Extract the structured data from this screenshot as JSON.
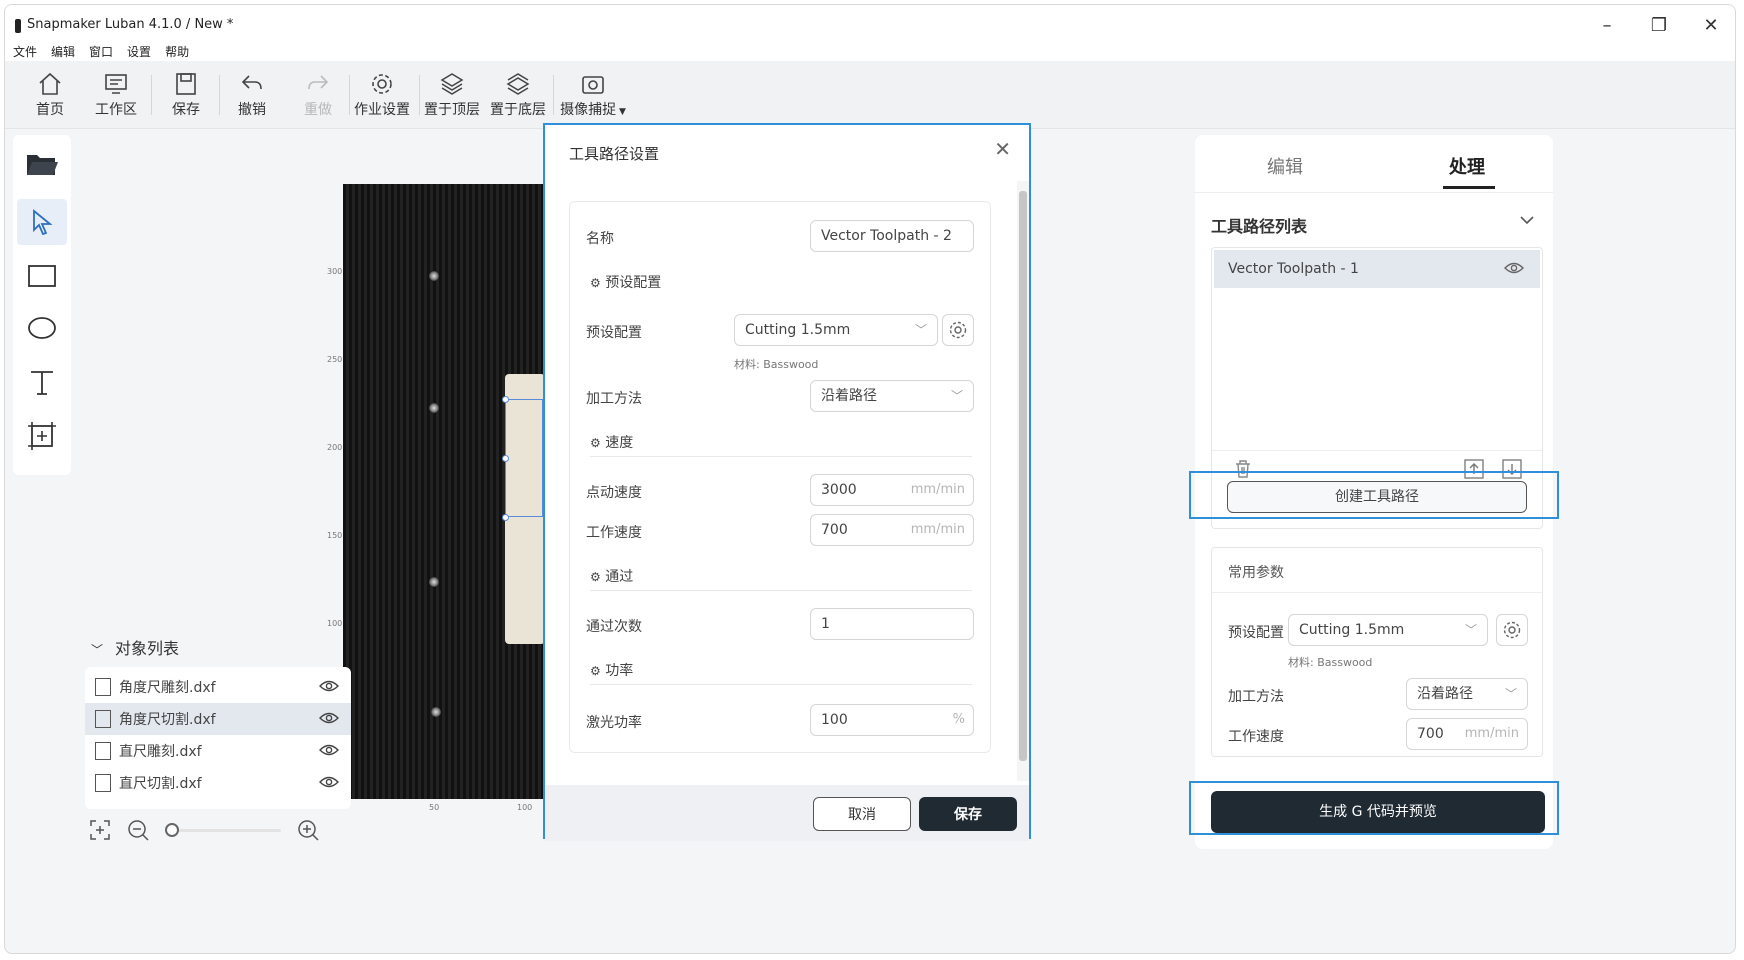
{
  "window": {
    "title": "Snapmaker Luban 4.1.0 / New *",
    "controls": {
      "minimize": "–",
      "restore": "❐",
      "close": "✕"
    }
  },
  "menu": [
    "文件",
    "编辑",
    "窗口",
    "设置",
    "帮助"
  ],
  "toolbar": {
    "home": "首页",
    "workspace": "工作区",
    "save": "保存",
    "undo": "撤销",
    "redo": "重做",
    "job_setup": "作业设置",
    "bring_to_front": "置于顶层",
    "send_to_back": "置于底层",
    "camera_capture": "摄像捕捉"
  },
  "canvas": {
    "y_ticks": [
      "300",
      "250",
      "200",
      "150",
      "100"
    ],
    "x_ticks": [
      "50",
      "100"
    ]
  },
  "object_list": {
    "title": "对象列表",
    "items": [
      {
        "name": "角度尺雕刻.dxf",
        "selected": false
      },
      {
        "name": "角度尺切割.dxf",
        "selected": true
      },
      {
        "name": "直尺雕刻.dxf",
        "selected": false
      },
      {
        "name": "直尺切割.dxf",
        "selected": false
      }
    ]
  },
  "dialog": {
    "title": "工具路径设置",
    "name_label": "名称",
    "name_value": "Vector Toolpath - 2",
    "preset_section": "预设配置",
    "preset_label": "预设配置",
    "preset_value": "Cutting 1.5mm",
    "material_note": "材料: Basswood",
    "method_label": "加工方法",
    "method_value": "沿着路径",
    "speed_section": "速度",
    "jog_speed_label": "点动速度",
    "jog_speed_value": "3000",
    "work_speed_label": "工作速度",
    "work_speed_value": "700",
    "speed_unit": "mm/min",
    "pass_section": "通过",
    "passes_label": "通过次数",
    "passes_value": "1",
    "power_section": "功率",
    "laser_power_label": "激光功率",
    "laser_power_value": "100",
    "power_unit": "%",
    "cancel": "取消",
    "save": "保存"
  },
  "right_panel": {
    "tab_edit": "编辑",
    "tab_process": "处理",
    "toolpath_list_title": "工具路径列表",
    "toolpaths": [
      "Vector Toolpath - 1"
    ],
    "create_toolpath": "创建工具路径",
    "common_params": "常用参数",
    "preset_label": "预设配置",
    "preset_value": "Cutting 1.5mm",
    "material_note": "材料: Basswood",
    "method_label": "加工方法",
    "method_value": "沿着路径",
    "work_speed_label": "工作速度",
    "work_speed_value": "700",
    "speed_unit": "mm/min",
    "generate_gcode": "生成 G 代码并预览"
  },
  "colors": {
    "accent_highlight": "#2f8fd8",
    "primary_button": "#1f2a33",
    "selection": "#5b8ad9"
  }
}
